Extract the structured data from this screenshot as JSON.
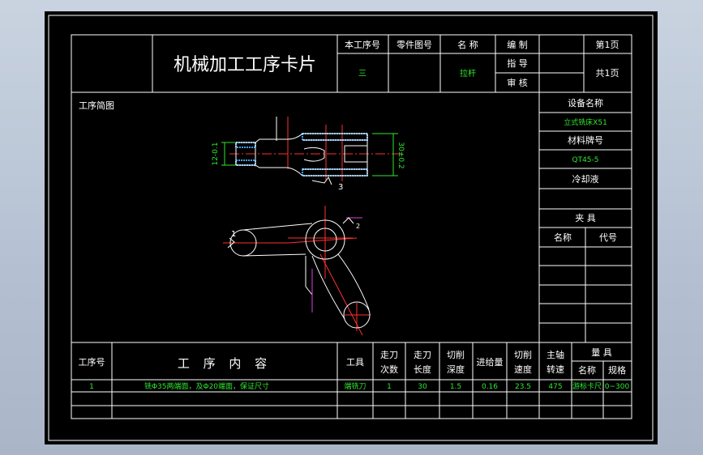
{
  "title": "机械加工工序卡片",
  "header": {
    "process_no_label": "本工序号",
    "part_drawing_label": "零件图号",
    "name_label": "名 称",
    "compile_label": "编 制",
    "check_label": "指 导",
    "review_label": "审 核",
    "page_label": "第1页",
    "total_label": "共1页",
    "process_no": "三",
    "part_name": "拉杆"
  },
  "sketch": {
    "label": "工序简图",
    "dim_left": "12-0.1",
    "dim_right": "30±0.2",
    "callout_3": "3",
    "callout_1": "1",
    "callout_2": "2"
  },
  "right_panel": {
    "equipment_label": "设备名称",
    "equipment": "立式铣床X51",
    "material_label": "材料牌号",
    "material": "QT45-5",
    "coolant_label": "冷却液",
    "fixture_label": "夹 具",
    "fixture_name_label": "名称",
    "fixture_code_label": "代号"
  },
  "table": {
    "headers": {
      "no": "工序号",
      "content": "工 序 内 容",
      "tool": "工具",
      "passes_1": "走刀",
      "passes_2": "次数",
      "length_1": "走刀",
      "length_2": "长度",
      "depth_1": "切削",
      "depth_2": "深度",
      "feed": "进给量",
      "speed_1": "切削",
      "speed_2": "速度",
      "spindle_1": "主轴",
      "spindle_2": "转速",
      "gauge": "量 具",
      "gauge_name": "名称",
      "gauge_spec": "规格"
    },
    "row": {
      "no": "1",
      "content": "铣Φ35两端面，及Φ20端面，保证尺寸",
      "tool": "端铣刀",
      "passes": "1",
      "length": "30",
      "depth": "1.5",
      "feed": "0.16",
      "speed": "23.5",
      "spindle": "475",
      "gauge_name": "游标卡尺",
      "gauge_spec": "0~300"
    }
  }
}
